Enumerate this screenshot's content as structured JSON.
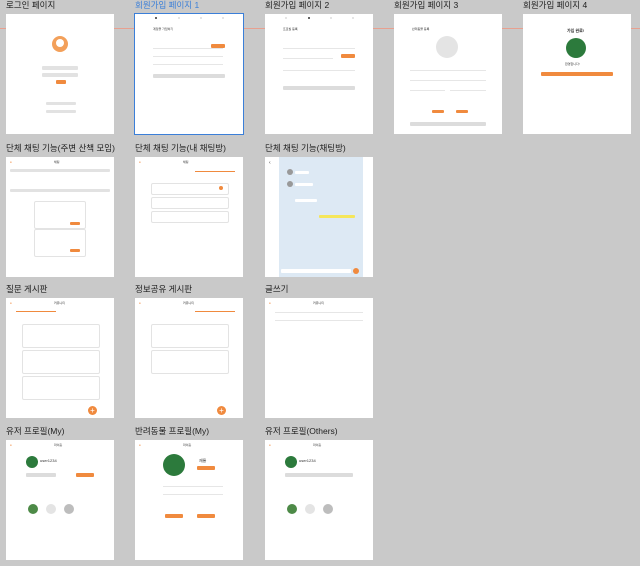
{
  "frames": [
    {
      "title": "로그인 페이지"
    },
    {
      "title": "회원가입 페이지 1"
    },
    {
      "title": "회원가입 페이지 2"
    },
    {
      "title": "회원가입 페이지 3"
    },
    {
      "title": "회원가입 페이지 4"
    },
    {
      "title": "단체 채팅 기능(주변 산책 모임)"
    },
    {
      "title": "단체 채팅 기능(내 채팅방)"
    },
    {
      "title": "단체 채팅 기능(채팅방)"
    },
    {
      "title": "질문 게시판"
    },
    {
      "title": "정보공유 게시판"
    },
    {
      "title": "글쓰기"
    },
    {
      "title": "유저 프로필(My)"
    },
    {
      "title": "반려동물 프로필(My)"
    },
    {
      "title": "유저 프로필(Others)"
    }
  ],
  "screens": {
    "signup1_heading": "계정을 가입하기",
    "signup2_heading": "프로필 등록",
    "signup3_heading": "반려동물 등록",
    "signup4_heading": "가입 완료!",
    "signup4_sub": "환영합니다!",
    "username": "user1234",
    "pet_name": "재롱",
    "chat_tab_title": "채팅",
    "board_tab_title": "커뮤니티",
    "profile_title": "마이홈",
    "fab_symbol": "+"
  },
  "colors": {
    "accent": "#f08a3e",
    "selection": "#3b7fd8",
    "canvas": "#c9c9c9"
  }
}
